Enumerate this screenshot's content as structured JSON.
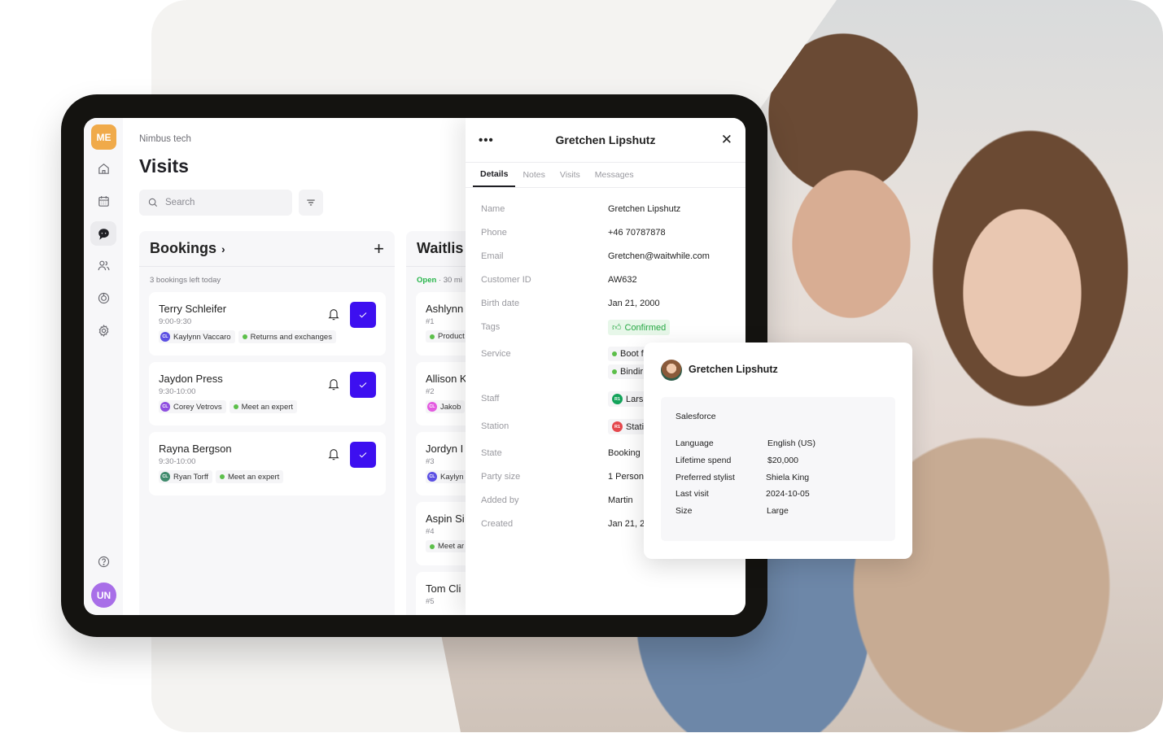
{
  "sidebar": {
    "user_initials": "ME",
    "bottom_initials": "UN",
    "items": [
      {
        "name": "home",
        "icon": "home-icon"
      },
      {
        "name": "calendar",
        "icon": "calendar-icon"
      },
      {
        "name": "visits",
        "icon": "chat-bubble-icon",
        "active": true
      },
      {
        "name": "customers",
        "icon": "users-icon"
      },
      {
        "name": "analytics",
        "icon": "chart-ring-icon"
      },
      {
        "name": "settings",
        "icon": "gear-icon"
      }
    ],
    "help_icon": "help-icon"
  },
  "header": {
    "org": "Nimbus tech",
    "title": "Visits",
    "search_placeholder": "Search"
  },
  "bookings": {
    "title": "Bookings",
    "subtitle": "3 bookings left today",
    "cards": [
      {
        "name": "Terry Schleifer",
        "time": "9:00-9:30",
        "staff_initials": "CL",
        "staff": "Kaylynn Vaccaro",
        "staff_color": "#5b4fe3",
        "service": "Returns and exchanges"
      },
      {
        "name": "Jaydon Press",
        "time": "9:30-10:00",
        "staff_initials": "CL",
        "staff": "Corey Vetrovs",
        "staff_color": "#8e4ee0",
        "service": "Meet an expert"
      },
      {
        "name": "Rayna Bergson",
        "time": "9:30-10:00",
        "staff_initials": "CL",
        "staff": "Ryan Torff",
        "staff_color": "#3f8a6c",
        "service": "Meet an expert"
      }
    ]
  },
  "waitlist": {
    "title": "Waitlis",
    "status": "Open",
    "wait": "· 30 mi",
    "cards": [
      {
        "name": "Ashlynn",
        "num": "#1",
        "tag": "Product",
        "tag_type": "service"
      },
      {
        "name": "Allison K",
        "num": "#2",
        "tag": "Jakob",
        "tag_type": "staff",
        "initials": "CL",
        "color": "#e35be0"
      },
      {
        "name": "Jordyn I",
        "num": "#3",
        "tag": "Kaylyn",
        "tag_type": "staff",
        "initials": "CL",
        "color": "#5b4fe3"
      },
      {
        "name": "Aspin Si",
        "num": "#4",
        "tag": "Meet ar",
        "tag_type": "service"
      },
      {
        "name": "Tom Cli",
        "num": "#5",
        "tag": "",
        "tag_type": "none"
      }
    ]
  },
  "drawer": {
    "title": "Gretchen Lipshutz",
    "tabs": [
      "Details",
      "Notes",
      "Visits",
      "Messages"
    ],
    "active_tab": "Details",
    "fields": {
      "name": {
        "label": "Name",
        "value": "Gretchen Lipshutz"
      },
      "phone": {
        "label": "Phone",
        "value": "+46 70787878"
      },
      "email": {
        "label": "Email",
        "value": "Gretchen@waitwhile.com"
      },
      "customer_id": {
        "label": "Customer ID",
        "value": "AW632"
      },
      "birth_date": {
        "label": "Birth date",
        "value": "Jan 21, 2000"
      },
      "tags": {
        "label": "Tags",
        "value": "Confirmed"
      },
      "service": {
        "label": "Service",
        "values": [
          "Boot f",
          "Bindir"
        ]
      },
      "staff": {
        "label": "Staff",
        "value": "Lars",
        "initials": "R1"
      },
      "station": {
        "label": "Station",
        "value": "Stati",
        "initials": "R1"
      },
      "state": {
        "label": "State",
        "value": "Booking"
      },
      "party_size": {
        "label": "Party size",
        "value": "1 Person"
      },
      "added_by": {
        "label": "Added by",
        "value": "Martin"
      },
      "created": {
        "label": "Created",
        "value": "Jan 21, 2"
      }
    }
  },
  "popup": {
    "name": "Gretchen Lipshutz",
    "section": "Salesforce",
    "rows": [
      {
        "key": "Language",
        "value": "English (US)"
      },
      {
        "key": "Lifetime spend",
        "value": "$20,000"
      },
      {
        "key": "Preferred stylist",
        "value": "Shiela King"
      },
      {
        "key": "Last visit",
        "value": "2024-10-05"
      },
      {
        "key": "Size",
        "value": "Large"
      }
    ]
  },
  "colors": {
    "accent": "#3d0ff0",
    "me_avatar": "#f0aa4a",
    "un_avatar": "#a86ee8",
    "open_status": "#27b54a",
    "tag_green": "#27a844",
    "staff_green": "#13a35a",
    "station_red": "#e5484d"
  }
}
